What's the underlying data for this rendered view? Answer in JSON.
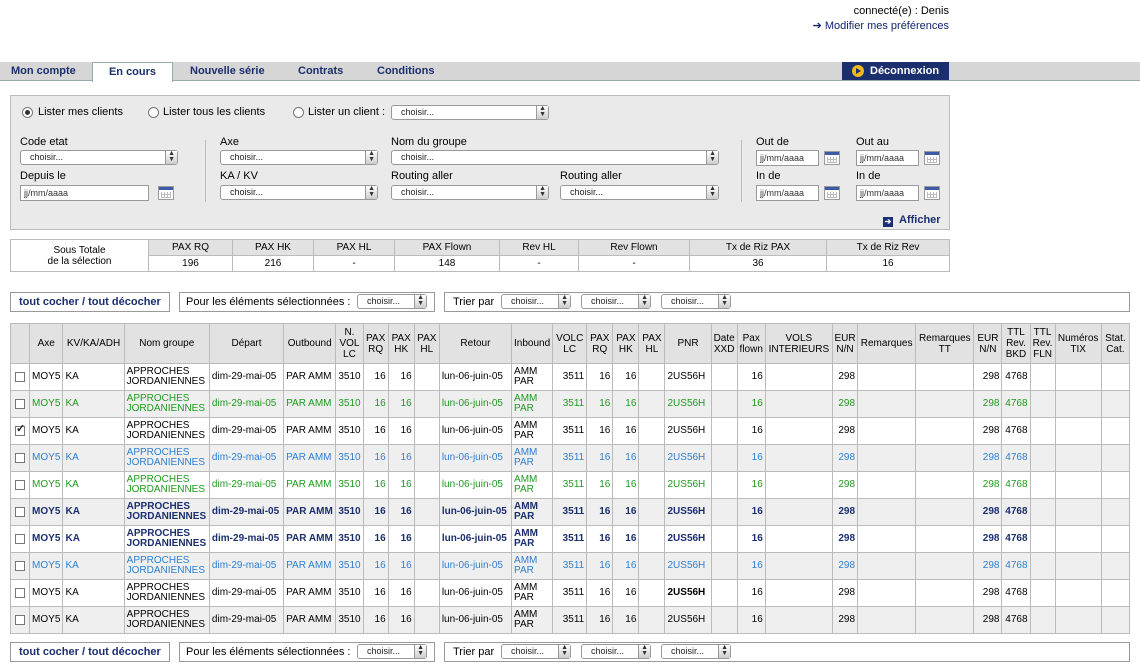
{
  "user": {
    "connected": "connecté(e) : Denis",
    "prefs": "Modifier mes préférences"
  },
  "tabs": [
    "Mon compte",
    "En cours",
    "Nouvelle série",
    "Contrats",
    "Conditions"
  ],
  "logout": "Déconnexion",
  "filter": {
    "radio1": "Lister mes clients",
    "radio2": "Lister tous les clients",
    "radio3": "Lister un client :",
    "choose": "choisir...",
    "code_etat": "Code etat",
    "depuis_le": "Depuis le",
    "axe": "Axe",
    "ka_kv": "KA / KV",
    "nom_groupe": "Nom du groupe",
    "routing_aller": "Routing aller",
    "out_de": "Out de",
    "out_au": "Out au",
    "in_de": "In de",
    "date_ph": "jj/mm/aaaa",
    "afficher": "Afficher"
  },
  "subtotal": {
    "label1": "Sous Totale",
    "label2": "de la sélection",
    "headers": [
      "PAX RQ",
      "PAX HK",
      "PAX HL",
      "PAX Flown",
      "Rev HL",
      "Rev Flown",
      "Tx de Riz PAX",
      "Tx de Riz Rev"
    ],
    "values": [
      "196",
      "216",
      "-",
      "148",
      "-",
      "-",
      "36",
      "16"
    ]
  },
  "actions": {
    "tout_cocher": "tout cocher",
    "sep": " / ",
    "tout_decocher": "tout décocher",
    "pour_les": "Pour les éléments sélectionnées :",
    "trier_par": "Trier par",
    "choose": "choisir..."
  },
  "table": {
    "headers": [
      "Axe",
      "KV/KA/ADH",
      "Nom groupe",
      "Départ",
      "Outbound",
      "N. VOL LC",
      "PAX RQ",
      "PAX HK",
      "PAX HL",
      "Retour",
      "Inbound",
      "VOLC LC",
      "PAX RQ",
      "PAX HK",
      "PAX HL",
      "PNR",
      "Date XXD",
      "Pax flown",
      "VOLS INTERIEURS",
      "EUR N/N",
      "Remarques",
      "Remarques TT",
      "EUR N/N",
      "TTL Rev. BKD",
      "TTL Rev. FLN",
      "Numéros TIX",
      "Stat. Cat."
    ],
    "rows": [
      {
        "style": "c-white",
        "checked": false,
        "cells": [
          "MOY5",
          "KA",
          "APPROCHES JORDANIENNES",
          "dim-29-mai-05",
          "PAR AMM",
          "3510",
          "16",
          "16",
          "",
          "lun-06-juin-05",
          "AMM PAR",
          "3511",
          "16",
          "16",
          "",
          "2US56H",
          "",
          "16",
          "",
          "298",
          "",
          "",
          "298",
          "4768",
          "",
          "",
          ""
        ]
      },
      {
        "style": "c-green c-gray",
        "checked": false,
        "cells": [
          "MOY5",
          "KA",
          "APPROCHES JORDANIENNES",
          "dim-29-mai-05",
          "PAR AMM",
          "3510",
          "16",
          "16",
          "",
          "lun-06-juin-05",
          "AMM PAR",
          "3511",
          "16",
          "16",
          "",
          "2US56H",
          "",
          "16",
          "",
          "298",
          "",
          "",
          "298",
          "4768",
          "",
          "",
          ""
        ]
      },
      {
        "style": "c-white",
        "checked": true,
        "cells": [
          "MOY5",
          "KA",
          "APPROCHES JORDANIENNES",
          "dim-29-mai-05",
          "PAR AMM",
          "3510",
          "16",
          "16",
          "",
          "lun-06-juin-05",
          "AMM PAR",
          "3511",
          "16",
          "16",
          "",
          "2US56H",
          "",
          "16",
          "",
          "298",
          "",
          "",
          "298",
          "4768",
          "",
          "",
          ""
        ]
      },
      {
        "style": "c-blue c-gray",
        "checked": false,
        "cells": [
          "MOY5",
          "KA",
          "APPROCHES JORDANIENNES",
          "dim-29-mai-05",
          "PAR AMM",
          "3510",
          "16",
          "16",
          "",
          "lun-06-juin-05",
          "AMM PAR",
          "3511",
          "16",
          "16",
          "",
          "2US56H",
          "",
          "16",
          "",
          "298",
          "",
          "",
          "298",
          "4768",
          "",
          "",
          ""
        ]
      },
      {
        "style": "c-green",
        "checked": false,
        "cells": [
          "MOY5",
          "KA",
          "APPROCHES JORDANIENNES",
          "dim-29-mai-05",
          "PAR AMM",
          "3510",
          "16",
          "16",
          "",
          "lun-06-juin-05",
          "AMM PAR",
          "3511",
          "16",
          "16",
          "",
          "2US56H",
          "",
          "16",
          "",
          "298",
          "",
          "",
          "298",
          "4768",
          "",
          "",
          ""
        ]
      },
      {
        "style": "c-bold c-gray",
        "checked": false,
        "cells": [
          "MOY5",
          "KA",
          "APPROCHES JORDANIENNES",
          "dim-29-mai-05",
          "PAR AMM",
          "3510",
          "16",
          "16",
          "",
          "lun-06-juin-05",
          "AMM PAR",
          "3511",
          "16",
          "16",
          "",
          "2US56H",
          "",
          "16",
          "",
          "298",
          "",
          "",
          "298",
          "4768",
          "",
          "",
          ""
        ]
      },
      {
        "style": "c-bold",
        "checked": false,
        "cells": [
          "MOY5",
          "KA",
          "APPROCHES JORDANIENNES",
          "dim-29-mai-05",
          "PAR AMM",
          "3510",
          "16",
          "16",
          "",
          "lun-06-juin-05",
          "AMM PAR",
          "3511",
          "16",
          "16",
          "",
          "2US56H",
          "",
          "16",
          "",
          "298",
          "",
          "",
          "298",
          "4768",
          "",
          "",
          ""
        ]
      },
      {
        "style": "c-blue c-gray",
        "checked": false,
        "cells": [
          "MOY5",
          "KA",
          "APPROCHES JORDANIENNES",
          "dim-29-mai-05",
          "PAR AMM",
          "3510",
          "16",
          "16",
          "",
          "lun-06-juin-05",
          "AMM PAR",
          "3511",
          "16",
          "16",
          "",
          "2US56H",
          "",
          "16",
          "",
          "298",
          "",
          "",
          "298",
          "4768",
          "",
          "",
          ""
        ]
      },
      {
        "style": "c-white",
        "checked": false,
        "cells": [
          "MOY5",
          "KA",
          "APPROCHES JORDANIENNES",
          "dim-29-mai-05",
          "PAR AMM",
          "3510",
          "16",
          "16",
          "",
          "lun-06-juin-05",
          "AMM PAR",
          "3511",
          "16",
          "16",
          "",
          "2US56H",
          "",
          "16",
          "",
          "298",
          "",
          "",
          "298",
          "4768",
          "",
          "",
          ""
        ]
      },
      {
        "style": "c-gray",
        "checked": false,
        "cells": [
          "MOY5",
          "KA",
          "APPROCHES JORDANIENNES",
          "dim-29-mai-05",
          "PAR AMM",
          "3510",
          "16",
          "16",
          "",
          "lun-06-juin-05",
          "AMM PAR",
          "3511",
          "16",
          "16",
          "",
          "2US56H",
          "",
          "16",
          "",
          "298",
          "",
          "",
          "298",
          "4768",
          "",
          "",
          ""
        ]
      }
    ]
  }
}
